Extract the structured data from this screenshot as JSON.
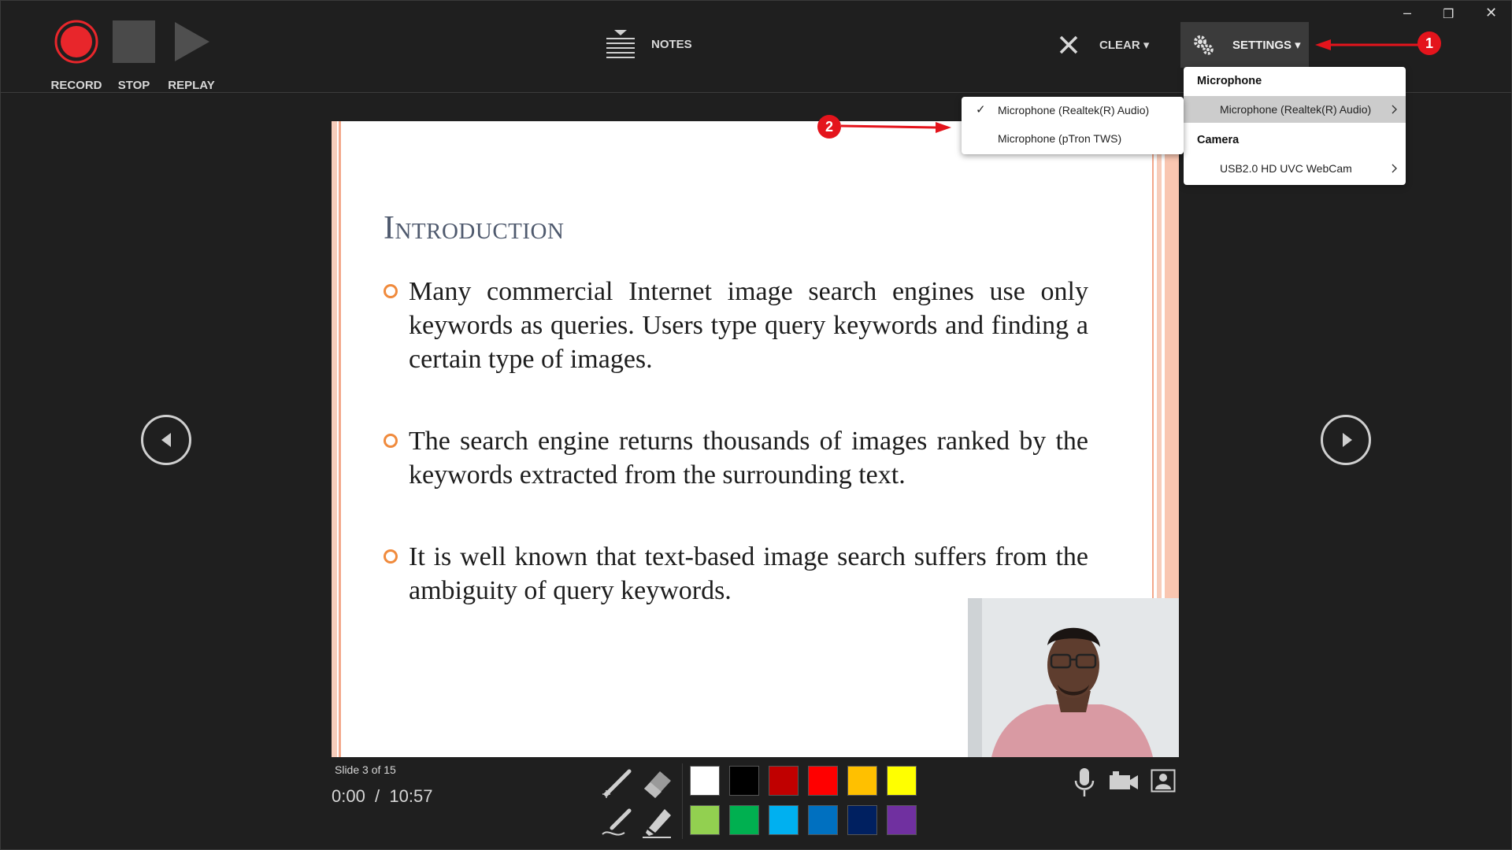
{
  "toolbar": {
    "record_label": "RECORD",
    "stop_label": "STOP",
    "replay_label": "REPLAY",
    "notes_label": "NOTES",
    "clear_label": "CLEAR ▾",
    "settings_label": "SETTINGS ▾"
  },
  "window_controls": {
    "minimize": "–",
    "restore": "❐",
    "close": "✕"
  },
  "slide": {
    "title": "Introduction",
    "bullets": [
      "Many commercial Internet image search engines use only keywords as queries. Users type query keywords and finding a certain type of images.",
      "The search engine returns thousands of images ranked by the keywords extracted from the surrounding text.",
      "It is well known that text-based image search suffers from the ambiguity of query keywords."
    ]
  },
  "status": {
    "slide_counter": "Slide 3 of 15",
    "timer": "0:00  /  10:57"
  },
  "settings_menu": {
    "microphone_header": "Microphone",
    "microphone_item": "Microphone (Realtek(R) Audio)",
    "camera_header": "Camera",
    "camera_item": "USB2.0 HD UVC WebCam"
  },
  "microphone_submenu": {
    "items": [
      {
        "label": "Microphone (Realtek(R) Audio)",
        "checked": true
      },
      {
        "label": "Microphone (pTron TWS)",
        "checked": false
      }
    ],
    "check_mark": "✓"
  },
  "annotations": {
    "marker_1": "1",
    "marker_2": "2",
    "color": "#e4141c"
  },
  "ink_colors": {
    "row1": [
      "#ffffff",
      "#000000",
      "#c00000",
      "#ff0000",
      "#ffc000",
      "#ffff00"
    ],
    "row2": [
      "#92d050",
      "#00b050",
      "#00b0f0",
      "#0070c0",
      "#002060",
      "#7030a0"
    ]
  },
  "icons": {
    "record": "record-icon",
    "stop": "stop-icon",
    "replay": "replay-icon",
    "notes": "notes-icon",
    "clear": "clear-x-icon",
    "settings": "settings-gear-icon",
    "prev": "previous-slide-icon",
    "next": "next-slide-icon",
    "laser": "laser-pointer-icon",
    "eraser": "eraser-icon",
    "pen": "pen-icon",
    "highlighter": "highlighter-icon",
    "mic": "microphone-icon",
    "camera": "camera-icon",
    "camera_preview": "camera-preview-icon"
  }
}
